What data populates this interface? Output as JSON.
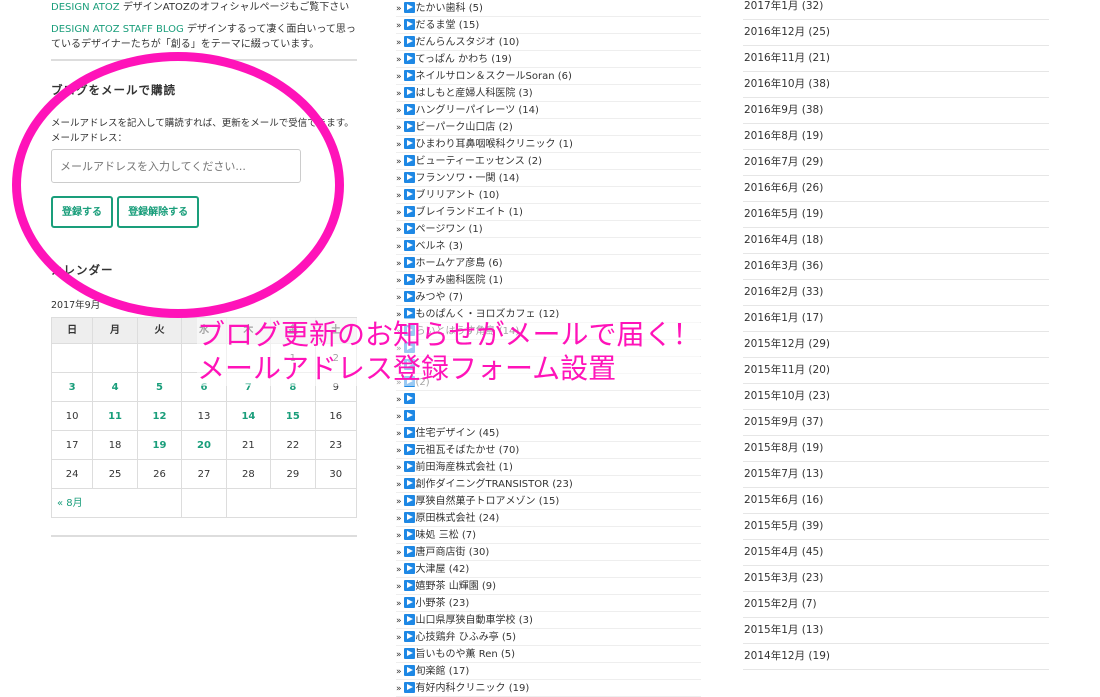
{
  "links": [
    {
      "name": "DESIGN ATOZ",
      "desc": "デザインATOZのオフィシャルページもご覧下さい"
    },
    {
      "name": "DESIGN ATOZ STAFF BLOG",
      "desc": "デザインするって凄く面白いって思っているデザイナーたちが「創る」をテーマに綴っています。"
    }
  ],
  "subscribe": {
    "title": "ブログをメールで購読",
    "description": "メールアドレスを記入して購読すれば、更新をメールで受信できます。",
    "email_label": "メールアドレス：",
    "email_placeholder": "メールアドレスを入力してください...",
    "subscribe_button": "登録する",
    "unsubscribe_button": "登録解除する"
  },
  "calendar": {
    "title": "カレンダー",
    "caption": "2017年9月",
    "weekdays": [
      "日",
      "月",
      "火",
      "水",
      "木",
      "金",
      "土"
    ],
    "weeks": [
      [
        "",
        "",
        "",
        "",
        "",
        "1",
        "2"
      ],
      [
        "3",
        "4",
        "5",
        "6",
        "7",
        "8",
        "9"
      ],
      [
        "10",
        "11",
        "12",
        "13",
        "14",
        "15",
        "16"
      ],
      [
        "17",
        "18",
        "19",
        "20",
        "21",
        "22",
        "23"
      ],
      [
        "24",
        "25",
        "26",
        "27",
        "28",
        "29",
        "30"
      ]
    ],
    "linked_days": [
      "3",
      "4",
      "5",
      "6",
      "7",
      "8",
      "11",
      "12",
      "14",
      "15",
      "19",
      "20"
    ],
    "prev_link": "« 8月"
  },
  "categories": [
    "たかい歯科 (5)",
    "だるま堂 (15)",
    "だんらんスタジオ (10)",
    "てっぱん かわち (19)",
    "ネイルサロン＆スクールSoran (6)",
    "はしもと産婦人科医院 (3)",
    "ハングリーパイレーツ (14)",
    "ビーパーク山口店 (2)",
    "ひまわり耳鼻咽喉科クリニック (1)",
    "ビューティーエッセンス (2)",
    "フランソワ・一関 (14)",
    "ブリリアント (10)",
    "ブレイランドエイト (1)",
    "ページワン (1)",
    "ベルネ (3)",
    "ホームケア彦島 (6)",
    "みすみ歯科医院 (1)",
    "みつや (7)",
    "ものぱんく・ヨロズカフェ (12)",
    "らいとはうす角島 (14)",
    "",
    "",
    "(2)",
    "",
    "",
    "住宅デザイン (45)",
    "元祖瓦そばたかせ (70)",
    "前田海産株式会社 (1)",
    "創作ダイニングTRANSISTOR (23)",
    "厚狭自然菓子トロアメゾン (15)",
    "原田株式会社 (24)",
    "味処 三松 (7)",
    "唐戸商店街 (30)",
    "大津屋 (42)",
    "嬉野茶 山輝園 (9)",
    "小野茶 (23)",
    "山口県厚狭自動車学校 (3)",
    "心技鶏弁 ひふみ亭 (5)",
    "旨いものや薫 Ren (5)",
    "旬楽館 (17)",
    "有好内科クリニック (19)"
  ],
  "archives": [
    "2017年1月 (32)",
    "2016年12月 (25)",
    "2016年11月 (21)",
    "2016年10月 (38)",
    "2016年9月 (38)",
    "2016年8月 (19)",
    "2016年7月 (29)",
    "2016年6月 (26)",
    "2016年5月 (19)",
    "2016年4月 (18)",
    "2016年3月 (36)",
    "2016年2月 (33)",
    "2016年1月 (17)",
    "2015年12月 (29)",
    "2015年11月 (20)",
    "2015年10月 (23)",
    "2015年9月 (37)",
    "2015年8月 (19)",
    "2015年7月 (13)",
    "2015年6月 (16)",
    "2015年5月 (39)",
    "2015年4月 (45)",
    "2015年3月 (23)",
    "2015年2月 (7)",
    "2015年1月 (13)",
    "2014年12月 (19)"
  ],
  "overlay": {
    "line1": "ブログ更新のお知らせがメールで届く！",
    "line2": "メールアドレス登録フォーム設置"
  },
  "colors": {
    "accent_green": "#1a9e7b",
    "highlight_pink": "#ff13b9",
    "category_icon_blue": "#1e88e5"
  }
}
